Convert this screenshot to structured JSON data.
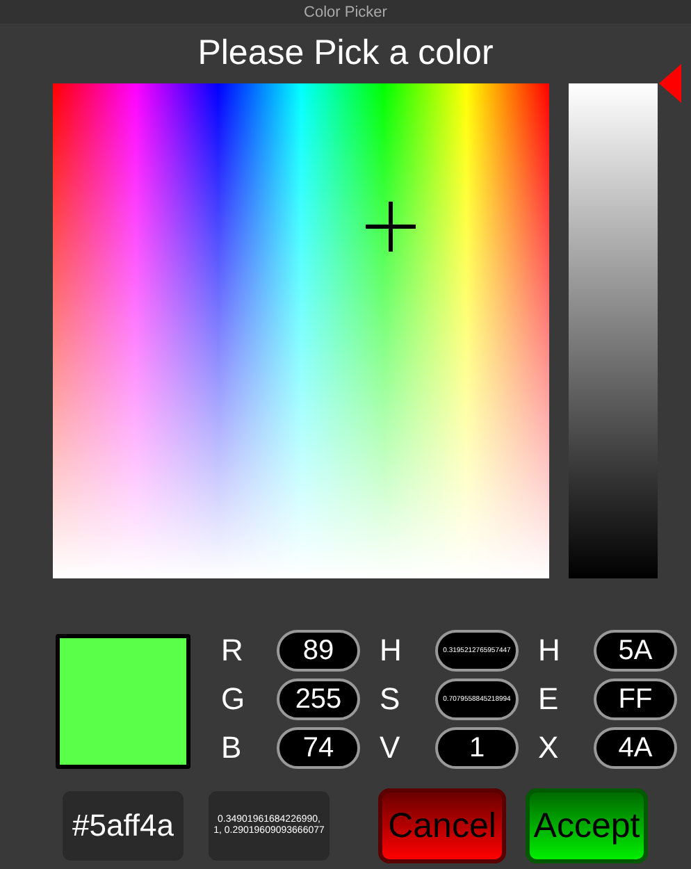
{
  "window": {
    "title": "Color Picker"
  },
  "heading": "Please Pick a color",
  "swatch": {
    "color": "#5aff4a"
  },
  "fields": [
    {
      "label": "R",
      "value": "89"
    },
    {
      "label": "H",
      "value": "0.3195212765957447"
    },
    {
      "label": "H",
      "value": "5A"
    },
    {
      "label": "G",
      "value": "255"
    },
    {
      "label": "S",
      "value": "0.7079558845218994"
    },
    {
      "label": "E",
      "value": "FF"
    },
    {
      "label": "B",
      "value": "74"
    },
    {
      "label": "V",
      "value": "1"
    },
    {
      "label": "X",
      "value": "4A"
    }
  ],
  "hex": "#5aff4a",
  "color3": "0.34901961684226990, 1, 0.29019609093666077",
  "buttons": [
    {
      "label": "Cancel",
      "kind": "cancel"
    },
    {
      "label": "Accept",
      "kind": "accept"
    }
  ]
}
